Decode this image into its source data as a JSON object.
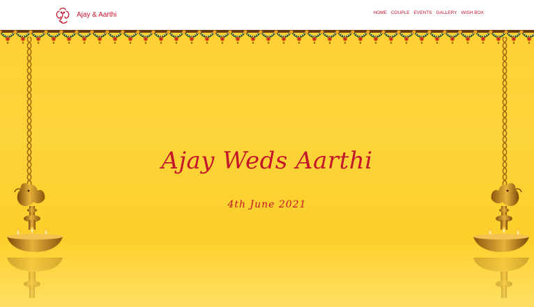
{
  "brand": {
    "name": "Ajay & Aarthi",
    "logo_icon": "ganesha-icon"
  },
  "nav": {
    "items": [
      "HOME",
      "COUPLE",
      "EVENTS",
      "GALLERY",
      "WISH BOX"
    ]
  },
  "hero": {
    "title": "Ajay Weds Aarthi",
    "date": "4th June 2021",
    "decorations": [
      "marigold-garland",
      "hanging-chain",
      "oil-lamp"
    ]
  },
  "colors": {
    "accent": "#c4162b",
    "background": "#fdd235",
    "gold": "#b8860b"
  }
}
